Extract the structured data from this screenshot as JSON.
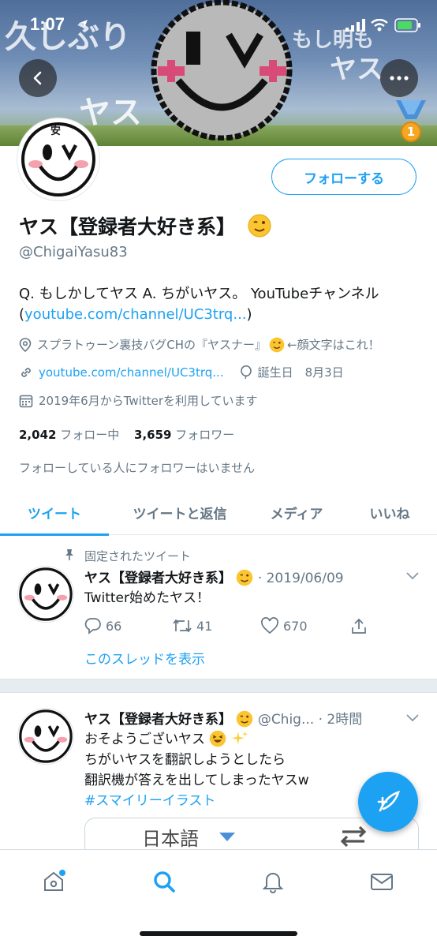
{
  "status_bar": {
    "time": "1:07"
  },
  "banner": {
    "text_left": "久しぶり",
    "text_right": "もし明も",
    "text_right2": "ヤス",
    "text_mid": "ヤス"
  },
  "profile": {
    "name": "ヤス【登録者大好き系】",
    "handle": "@ChigaiYasu83",
    "follow_button": "フォローする",
    "avatar_badge": "安",
    "bio_line1": "Q. もしかしてヤス A. ちがいヤス。 YouTubeチャンネル",
    "bio_link_open": "(",
    "bio_link": "youtube.com/channel/UC3trq...",
    "bio_link_close": ")",
    "location": "スプラトゥーン裏技バグCHの『ヤスナー』",
    "location_suffix": "←顔文字はこれ！",
    "website": "youtube.com/channel/UC3trq...",
    "birthday": "誕生日　8月3日",
    "joined": "2019年6月からTwitterを利用しています",
    "following_count": "2,042",
    "following_label": "フォロー中",
    "followers_count": "3,659",
    "followers_label": "フォロワー",
    "no_mutual_note": "フォローしている人にフォロワーはいません",
    "achievement_badge": "1"
  },
  "tabs": [
    "ツイート",
    "ツイートと返信",
    "メディア",
    "いいね"
  ],
  "tweets": [
    {
      "pinned_label": "固定されたツイート",
      "name": "ヤス【登録者大好き系】",
      "meta": "· 2019/06/09",
      "text": "Twitter始めたヤス！",
      "replies": "66",
      "retweets": "41",
      "likes": "670",
      "thread_link": "このスレッドを表示"
    },
    {
      "name": "ヤス【登録者大好き系】",
      "handle": "@Chig...",
      "meta": "· 2時間",
      "line1": "おそようございヤス",
      "line2": "ちがいヤスを翻訳しようとしたら",
      "line3": "翻訳機が答えを出してしまったヤスw",
      "hashtag": "#スマイリーイラスト",
      "card_lang_left": "日本語"
    }
  ],
  "colors": {
    "accent": "#1da1f2",
    "text": "#14171a",
    "muted": "#657786",
    "divider": "#e6ecf0"
  },
  "icons": [
    "back-arrow-icon",
    "more-icon",
    "medal-icon",
    "location-pin-icon",
    "link-icon",
    "balloon-icon",
    "calendar-icon",
    "pin-icon",
    "reply-icon",
    "retweet-icon",
    "like-icon",
    "share-icon",
    "chevron-down-icon",
    "compose-icon",
    "home-icon",
    "search-icon",
    "bell-icon",
    "mail-icon"
  ]
}
